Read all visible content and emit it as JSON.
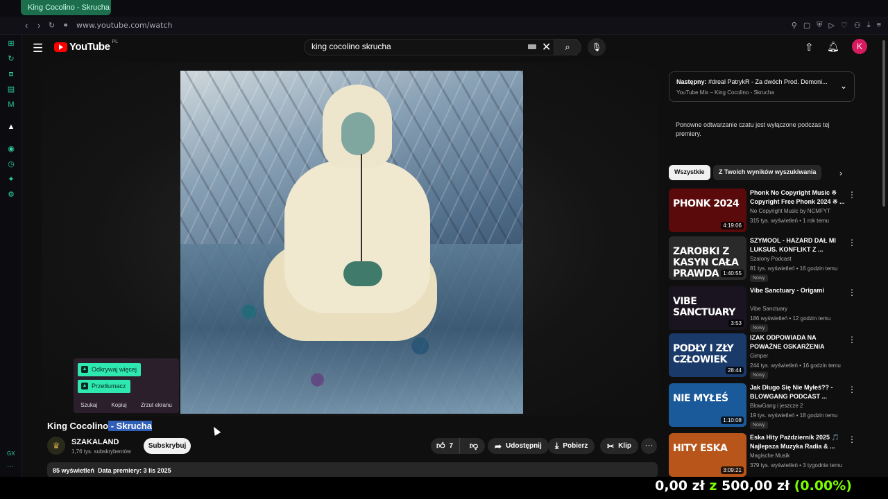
{
  "browser": {
    "tab_title": "King Cocolino - Skrucha",
    "url": "www.youtube.com/watch",
    "gx_label": "GX"
  },
  "header": {
    "logo_text": "YouTube",
    "country_code": "PL",
    "search_value": "king cocolino skrucha",
    "avatar_letter": "K"
  },
  "gx_popup": {
    "chip1": "Odkrywaj więcej",
    "chip2": "Przetłumacz",
    "actions": [
      "Szukaj",
      "Kopiuj",
      "Zrzut ekranu"
    ]
  },
  "video": {
    "title_plain": "King Cocolino",
    "title_highlight": " - Skrucha",
    "channel": "SZAKALAND",
    "subscribers": "1,76 tys. subskrybentów",
    "subscribe_label": "Subskrybuj",
    "likes": "7",
    "share_label": "Udostępnij",
    "download_label": "Pobierz",
    "clip_label": "Klip",
    "views": "85 wyświetleń",
    "premiere": "Data premiery: 3 lis 2025"
  },
  "sidebar": {
    "next_prefix": "Następny:",
    "next_title": " #dreal PatrykR - Za dwóch Prod. Demoni...",
    "next_sub": "YouTube Mix – King Cocolino - Skrucha",
    "chat_note": "Ponowne odtwarzanie czatu jest wyłączone podczas tej premiery.",
    "chips": [
      "Wszystkie",
      "Z Twoich wyników wyszukiwania"
    ],
    "recommendations": [
      {
        "title": "Phonk No Copyright Music ※ Copyright Free Phonk 2024 ※ ...",
        "channel": "No Copyright Music by NCMFYT",
        "meta": "315 tys. wyświetleń • 1 rok temu",
        "duration": "4:19:06",
        "thumb_text": "PHONK 2024",
        "badge": "",
        "thumb_color": "#5a0a0a"
      },
      {
        "title": "SZYMOOL - HAZARD DAŁ MI LUKSUS. KONFLIKT Z ...",
        "channel": "Szalony Podcast",
        "meta": "81 tys. wyświetleń • 16 godzin temu",
        "duration": "1:40:55",
        "thumb_text": "ZAROBKI Z KASYN CAŁA PRAWDA",
        "badge": "Nowy",
        "thumb_color": "#2a2a2a"
      },
      {
        "title": "Vibe Sanctuary - Origami",
        "channel": "Vibe Sanctuary",
        "meta": "186 wyświetleń • 12 godzin temu",
        "duration": "3:53",
        "thumb_text": "VIBE SANCTUARY",
        "badge": "Nowy",
        "thumb_color": "#1a1420"
      },
      {
        "title": "IZAK ODPOWIADA NA POWAŻNE OSKARŻENIA",
        "channel": "Gimper",
        "meta": "244 tys. wyświetleń • 16 godzin temu",
        "duration": "28:44",
        "thumb_text": "PODŁY I ZŁY CZŁOWIEK",
        "badge": "Nowy",
        "thumb_color": "#1a3a6a"
      },
      {
        "title": "Jak Długo Się Nie Myłeś?? - BLOWGANG PODCAST ...",
        "channel": "BlowGang i jeszcze 2",
        "meta": "19 tys. wyświetleń • 18 godzin temu",
        "duration": "1:10:08",
        "thumb_text": "NIE MYŁEŚ",
        "badge": "Nowy",
        "thumb_color": "#1a5a9a"
      },
      {
        "title": "Eska Hity Październik 2025 🎵 Najlepsza Muzyka Radia & ...",
        "channel": "Magische Musik",
        "meta": "379 tys. wyświetleń • 3 tygodnie temu",
        "duration": "3:09:21",
        "thumb_text": "HITY ESKA",
        "badge": "",
        "thumb_color": "#b8551a"
      }
    ]
  },
  "ticker": {
    "left": "0,00 zł",
    "mid": "z",
    "right": "500,00 zł",
    "pct": "(0.00%)"
  }
}
